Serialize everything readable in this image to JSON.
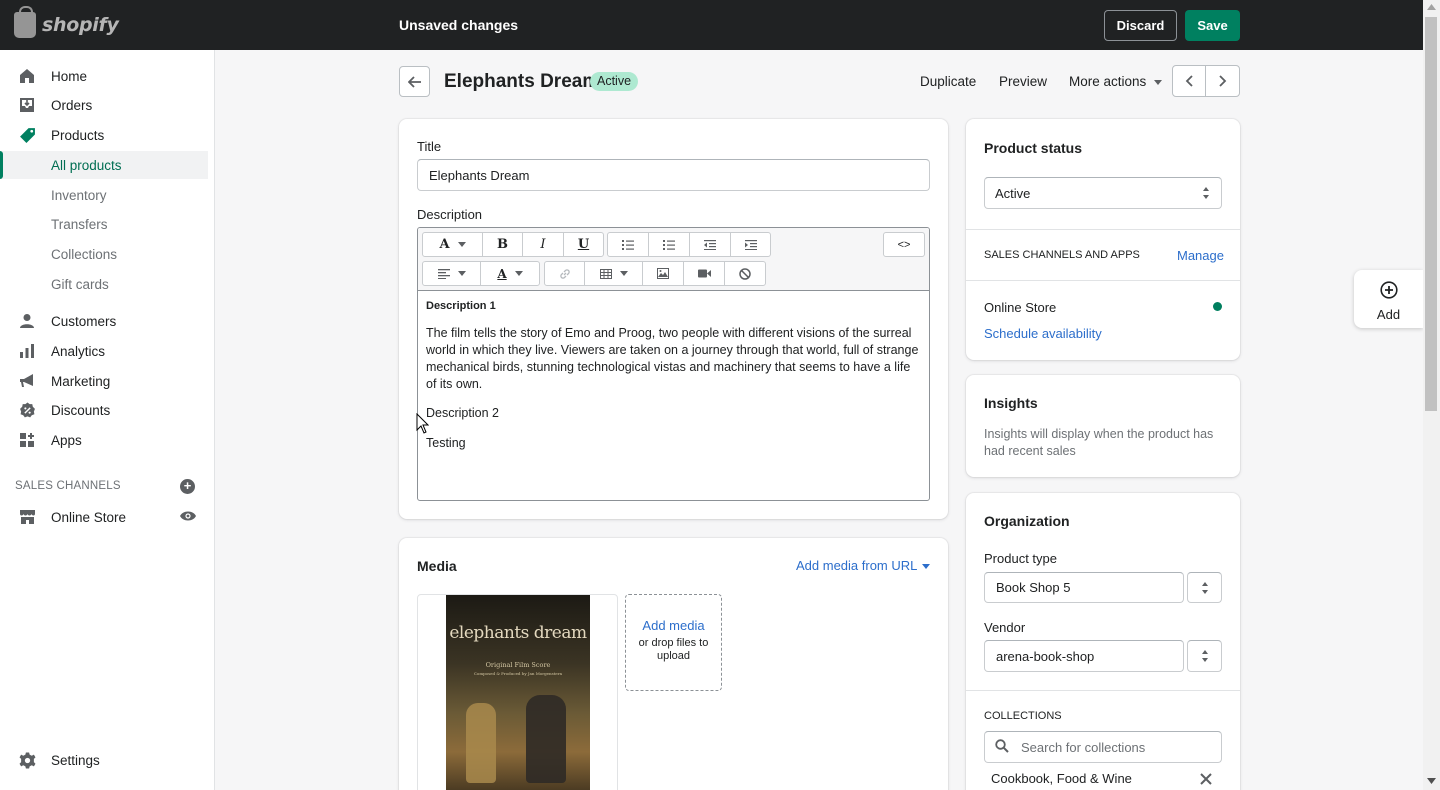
{
  "app": {
    "logo_text": "shopify",
    "unsaved_text": "Unsaved changes",
    "discard_label": "Discard",
    "save_label": "Save",
    "accent_color": "#008060"
  },
  "sidebar": {
    "items": [
      {
        "label": "Home",
        "icon": "home-icon"
      },
      {
        "label": "Orders",
        "icon": "orders-icon"
      },
      {
        "label": "Products",
        "icon": "tag-icon"
      },
      {
        "label": "All products"
      },
      {
        "label": "Inventory"
      },
      {
        "label": "Transfers"
      },
      {
        "label": "Collections"
      },
      {
        "label": "Gift cards"
      },
      {
        "label": "Customers",
        "icon": "person-icon"
      },
      {
        "label": "Analytics",
        "icon": "bar-chart-icon"
      },
      {
        "label": "Marketing",
        "icon": "megaphone-icon"
      },
      {
        "label": "Discounts",
        "icon": "discount-icon"
      },
      {
        "label": "Apps",
        "icon": "apps-icon"
      }
    ],
    "sales_channels_title": "SALES CHANNELS",
    "online_store": "Online Store",
    "settings": "Settings"
  },
  "header": {
    "title": "Elephants Dream",
    "status_badge": "Active",
    "duplicate": "Duplicate",
    "preview": "Preview",
    "more_actions": "More actions"
  },
  "product": {
    "title_label": "Title",
    "title_value": "Elephants Dream",
    "description_label": "Description",
    "html_toggle": "<>",
    "description": {
      "heading1": "Description 1",
      "paragraph1": "The film tells the story of Emo and Proog, two people with different visions of the surreal world in which they live. Viewers are taken on a journey through that world, full of strange mechanical birds, stunning technological vistas and machinery that seems to have a life of its own.",
      "heading2": "Description 2",
      "paragraph2": "Testing"
    }
  },
  "media": {
    "title": "Media",
    "add_from_url": "Add media from URL",
    "add_media": "Add media",
    "drop_hint": "or drop files to upload",
    "poster_title": "elephants dream",
    "poster_sub1": "Original Film Score",
    "poster_sub2": "Composed & Produced by Jan Morgenstern"
  },
  "status_card": {
    "title": "Product status",
    "selected": "Active",
    "channels_title": "SALES CHANNELS AND APPS",
    "manage": "Manage",
    "online_store": "Online Store",
    "schedule": "Schedule availability"
  },
  "insights": {
    "title": "Insights",
    "text": "Insights will display when the product has had recent sales"
  },
  "organization": {
    "title": "Organization",
    "product_type_label": "Product type",
    "product_type_value": "Book Shop 5",
    "vendor_label": "Vendor",
    "vendor_value": "arena-book-shop",
    "collections_title": "COLLECTIONS",
    "collections_placeholder": "Search for collections",
    "collection_tag": "Cookbook, Food & Wine"
  },
  "floating": {
    "add_label": "Add"
  }
}
